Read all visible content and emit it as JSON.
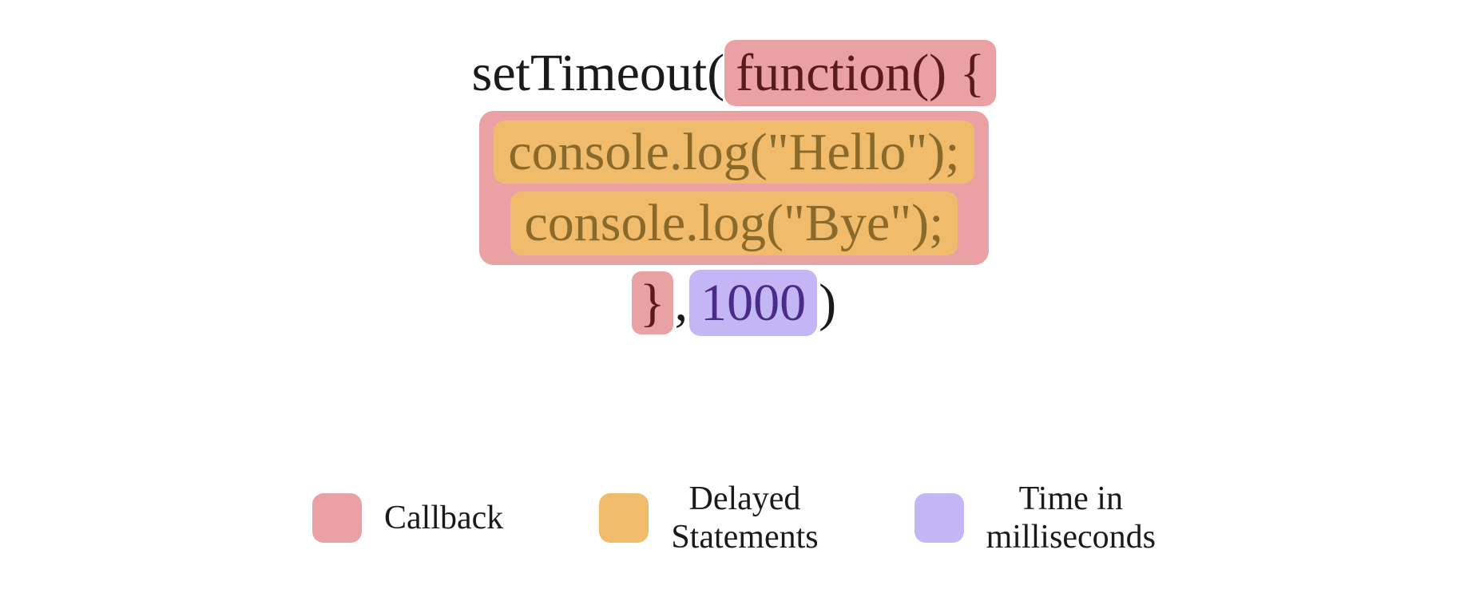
{
  "colors": {
    "callback": "#e9a1a4",
    "delayed": "#f0bb6a",
    "time": "#c4b6f4"
  },
  "code": {
    "line1_prefix": "setTimeout( ",
    "line1_callback": "function() {",
    "line2": "console.log(\"Hello\");",
    "line3": "console.log(\"Bye\");",
    "line4_brace": "}",
    "line4_comma": ",",
    "line4_time": "1000",
    "line4_close": ")"
  },
  "legend": {
    "callback": "Callback",
    "delayed_line1": "Delayed",
    "delayed_line2": "Statements",
    "time_line1": "Time in",
    "time_line2": "milliseconds"
  }
}
